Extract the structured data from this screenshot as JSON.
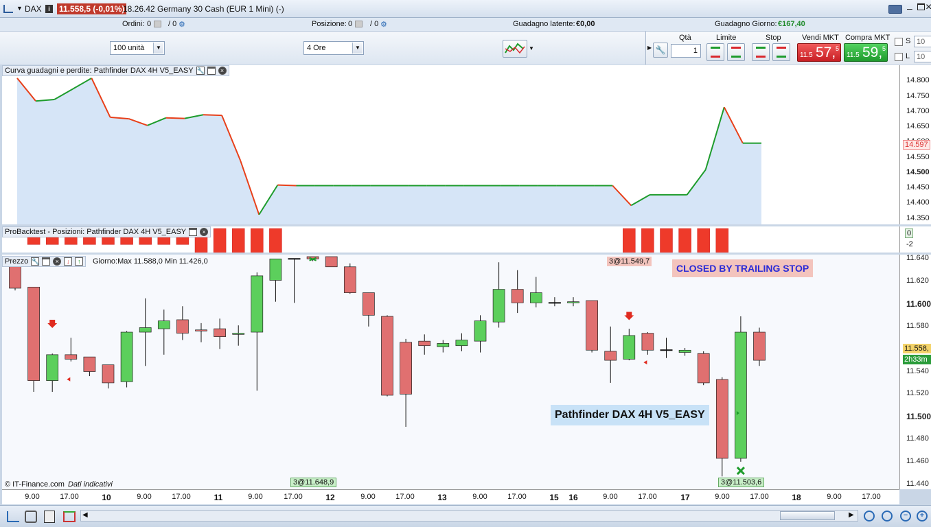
{
  "titlebar": {
    "app_label": "DAX",
    "price_badge": "11.558,5 (-0,01%)",
    "title": "18.26.42 Germany 30 Cash (EUR 1 Mini) (-)",
    "badge_color": "#c0392b"
  },
  "info": {
    "orders_label": "Ordini:",
    "orders_value": "0",
    "orders_total": "/ 0",
    "position_label": "Posizione:",
    "position_value": "0",
    "position_total": "/ 0",
    "latent_label": "Guadagno latente:",
    "latent_value": "€0,00",
    "daily_label": "Guadagno Giorno:",
    "daily_value": "€167,40"
  },
  "toolbar": {
    "units_select": "100 unità",
    "timeframe_select": "4 Ore",
    "qty_label": "Qtà",
    "qty_value": "1",
    "limit_label": "Limite",
    "stop_label": "Stop",
    "sell_label": "Vendi MKT",
    "sell_small": "11.5",
    "sell_big": "57,",
    "sell_sup": "5",
    "buy_label": "Compra MKT",
    "buy_small": "11.5",
    "buy_big": "59,",
    "buy_sup": "5",
    "s_label": "S",
    "l_label": "L",
    "s_value": "10",
    "l_value": "10",
    "sell_color": "#d9282d",
    "buy_color": "#2aa43c"
  },
  "equity_panel": {
    "title": "Curva guadagni e perdite: Pathfinder DAX 4H V5_EASY",
    "current_label": "14.597",
    "ticks": [
      "14.800",
      "14.750",
      "14.700",
      "14.650",
      "14.600",
      "14.550",
      "14.500",
      "14.450",
      "14.400",
      "14.350"
    ],
    "bold_ticks": [
      "14.500"
    ]
  },
  "positions_panel": {
    "title": "ProBacktest - Posizioni: Pathfinder DAX 4H V5_EASY",
    "ticks": [
      "0",
      "-2"
    ]
  },
  "price_panel": {
    "title": "Prezzo",
    "day_info": "Giorno:Max 11.588,0 Min 11.426,0",
    "ticks": [
      "11.640",
      "11.620",
      "11.600",
      "11.580",
      "11.560",
      "11.540",
      "11.520",
      "11.500",
      "11.480",
      "11.460",
      "11.440"
    ],
    "bold_ticks": [
      "11.600",
      "11.500"
    ],
    "current_price": "11.558,",
    "countdown": "2h33m",
    "closed_banner": "CLOSED BY TRAILING STOP",
    "strategy_banner": "Pathfinder DAX 4H V5_EASY",
    "trade_label_1": "3@11.549,7",
    "trade_label_2": "3@11.648,9",
    "trade_label_3": "3@11.503,6",
    "copyright": "© IT-Finance.com",
    "indicative": "Dati indicativi"
  },
  "xaxis": {
    "labels": [
      {
        "t": "9.00",
        "d": false
      },
      {
        "t": "17.00",
        "d": false
      },
      {
        "t": "10",
        "d": true
      },
      {
        "t": "9.00",
        "d": false
      },
      {
        "t": "17.00",
        "d": false
      },
      {
        "t": "11",
        "d": true
      },
      {
        "t": "9.00",
        "d": false
      },
      {
        "t": "17.00",
        "d": false
      },
      {
        "t": "12",
        "d": true
      },
      {
        "t": "9.00",
        "d": false
      },
      {
        "t": "17.00",
        "d": false
      },
      {
        "t": "13",
        "d": true
      },
      {
        "t": "9.00",
        "d": false
      },
      {
        "t": "17.00",
        "d": false
      },
      {
        "t": "15",
        "d": true
      },
      {
        "t": "16",
        "d": true
      },
      {
        "t": "9.00",
        "d": false
      },
      {
        "t": "17.00",
        "d": false
      },
      {
        "t": "17",
        "d": true
      },
      {
        "t": "9.00",
        "d": false
      },
      {
        "t": "17.00",
        "d": false
      },
      {
        "t": "18",
        "d": true
      },
      {
        "t": "9.00",
        "d": false
      },
      {
        "t": "17.00",
        "d": false
      }
    ]
  },
  "chart_data": [
    {
      "type": "line",
      "title": "Curva guadagni e perdite: Pathfinder DAX 4H V5_EASY",
      "ylim": [
        14340,
        14830
      ],
      "values": [
        14810,
        14735,
        14740,
        14775,
        14810,
        14682,
        14677,
        14655,
        14680,
        14678,
        14690,
        14688,
        14540,
        14363,
        14460,
        14458,
        14458,
        14458,
        14458,
        14458,
        14458,
        14458,
        14458,
        14458,
        14458,
        14458,
        14458,
        14458,
        14458,
        14458,
        14458,
        14458,
        14458,
        14393,
        14428,
        14428,
        14428,
        14510,
        14715,
        14597,
        14597
      ],
      "up_color": "#1e9c2c",
      "down_color": "#e8401a"
    },
    {
      "type": "bar",
      "title": "ProBacktest - Posizioni: Pathfinder DAX 4H V5_EASY",
      "ylim": [
        -3,
        0
      ],
      "values": [
        0,
        -2,
        -2,
        -2,
        -2,
        -2,
        -2,
        -2,
        -2,
        -2,
        -3,
        -3,
        -3,
        -3,
        -3,
        0,
        0,
        0,
        0,
        0,
        0,
        0,
        0,
        0,
        0,
        0,
        0,
        0,
        0,
        0,
        0,
        0,
        0,
        -3,
        -3,
        -3,
        -3,
        -3,
        -3,
        0,
        0
      ],
      "color": "#ee3a2a"
    },
    {
      "type": "candlestick",
      "title": "Prezzo",
      "ylim": [
        11438,
        11642
      ],
      "candles": [
        {
          "o": 11638,
          "h": 11640,
          "l": 11612,
          "c": 11614
        },
        {
          "o": 11615,
          "h": 11615,
          "l": 11522,
          "c": 11532
        },
        {
          "o": 11532,
          "h": 11556,
          "l": 11522,
          "c": 11555
        },
        {
          "o": 11555,
          "h": 11570,
          "l": 11549,
          "c": 11551
        },
        {
          "o": 11553,
          "h": 11553,
          "l": 11536,
          "c": 11540
        },
        {
          "o": 11546,
          "h": 11546,
          "l": 11525,
          "c": 11530
        },
        {
          "o": 11531,
          "h": 11576,
          "l": 11526,
          "c": 11575
        },
        {
          "o": 11575,
          "h": 11605,
          "l": 11545,
          "c": 11579
        },
        {
          "o": 11578,
          "h": 11595,
          "l": 11555,
          "c": 11585
        },
        {
          "o": 11586,
          "h": 11598,
          "l": 11568,
          "c": 11574
        },
        {
          "o": 11577,
          "h": 11583,
          "l": 11566,
          "c": 11576
        },
        {
          "o": 11578,
          "h": 11587,
          "l": 11560,
          "c": 11571
        },
        {
          "o": 11573,
          "h": 11581,
          "l": 11563,
          "c": 11574
        },
        {
          "o": 11575,
          "h": 11628,
          "l": 11523,
          "c": 11625
        },
        {
          "o": 11621,
          "h": 11640,
          "l": 11602,
          "c": 11640
        },
        {
          "o": 11640,
          "h": 11640,
          "l": 11601,
          "c": 11640
        },
        {
          "o": 11642,
          "h": 11642,
          "l": 11638,
          "c": 11640
        },
        {
          "o": 11642,
          "h": 11642,
          "l": 11633,
          "c": 11633
        },
        {
          "o": 11633,
          "h": 11636,
          "l": 11609,
          "c": 11610
        },
        {
          "o": 11610,
          "h": 11610,
          "l": 11580,
          "c": 11590
        },
        {
          "o": 11589,
          "h": 11590,
          "l": 11518,
          "c": 11519
        },
        {
          "o": 11566,
          "h": 11569,
          "l": 11491,
          "c": 11520
        },
        {
          "o": 11567,
          "h": 11573,
          "l": 11555,
          "c": 11563
        },
        {
          "o": 11562,
          "h": 11568,
          "l": 11557,
          "c": 11565
        },
        {
          "o": 11563,
          "h": 11574,
          "l": 11558,
          "c": 11568
        },
        {
          "o": 11567,
          "h": 11590,
          "l": 11557,
          "c": 11585
        },
        {
          "o": 11584,
          "h": 11637,
          "l": 11579,
          "c": 11613
        },
        {
          "o": 11613,
          "h": 11630,
          "l": 11592,
          "c": 11601
        },
        {
          "o": 11601,
          "h": 11624,
          "l": 11597,
          "c": 11610
        },
        {
          "o": 11601,
          "h": 11606,
          "l": 11598,
          "c": 11601
        },
        {
          "o": 11601,
          "h": 11606,
          "l": 11598,
          "c": 11602
        },
        {
          "o": 11603,
          "h": 11603,
          "l": 11557,
          "c": 11559
        },
        {
          "o": 11558,
          "h": 11580,
          "l": 11530,
          "c": 11550
        },
        {
          "o": 11551,
          "h": 11578,
          "l": 11550,
          "c": 11572
        },
        {
          "o": 11574,
          "h": 11575,
          "l": 11555,
          "c": 11559
        },
        {
          "o": 11559,
          "h": 11570,
          "l": 11552,
          "c": 11559
        },
        {
          "o": 11557,
          "h": 11561,
          "l": 11554,
          "c": 11559
        },
        {
          "o": 11556,
          "h": 11558,
          "l": 11528,
          "c": 11530
        },
        {
          "o": 11533,
          "h": 11535,
          "l": 11447,
          "c": 11463
        },
        {
          "o": 11463,
          "h": 11589,
          "l": 11460,
          "c": 11575
        },
        {
          "o": 11575,
          "h": 11579,
          "l": 11545,
          "c": 11550
        }
      ],
      "up_color": "#5ccf5c",
      "down_color": "#e07070"
    }
  ]
}
